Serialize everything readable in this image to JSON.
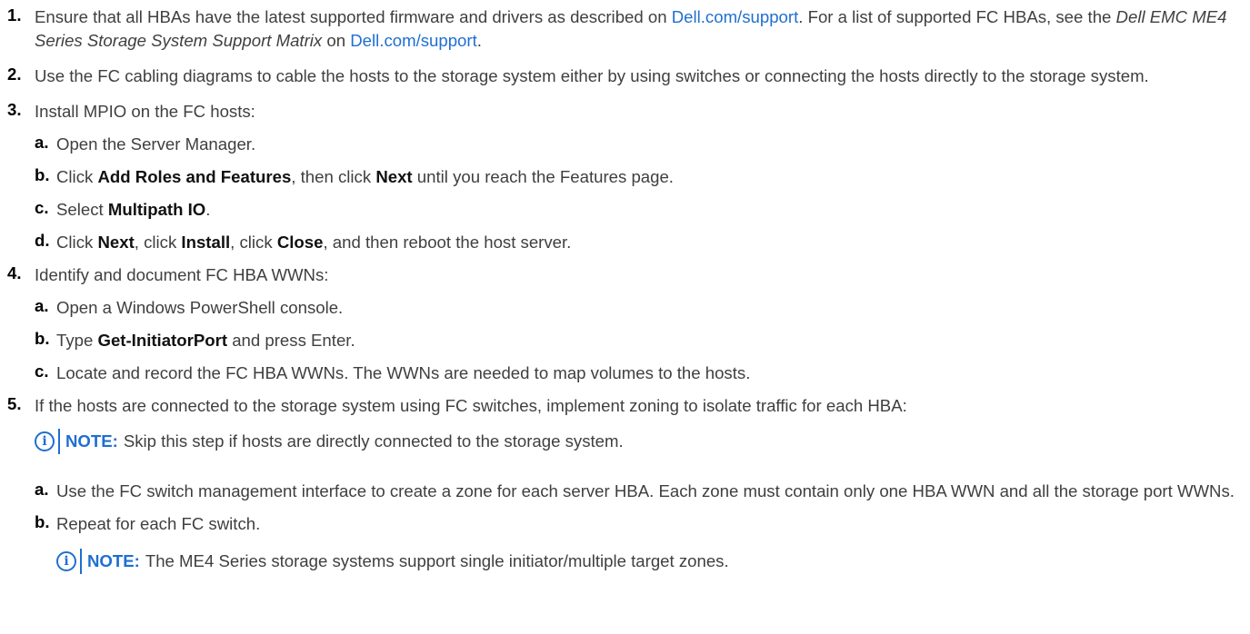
{
  "steps": [
    {
      "num": "1.",
      "p1": "Ensure that all HBAs have the latest supported firmware and drivers as described on ",
      "link1": "Dell.com/support",
      "p2": ". For a list of supported FC HBAs, see the ",
      "italic": "Dell EMC ME4 Series Storage System Support Matrix",
      "p3": " on ",
      "link2": "Dell.com/support",
      "p4": "."
    },
    {
      "num": "2.",
      "text": "Use the FC cabling diagrams to cable the hosts to the storage system either by using switches or connecting the hosts directly to the storage system."
    },
    {
      "num": "3.",
      "text": "Install MPIO on the FC hosts:",
      "sub": [
        {
          "num": "a.",
          "text": "Open the Server Manager."
        },
        {
          "num": "b.",
          "t1": "Click ",
          "b1": "Add Roles and Features",
          "t2": ", then click ",
          "b2": "Next",
          "t3": " until you reach the Features page."
        },
        {
          "num": "c.",
          "t1": "Select ",
          "b1": "Multipath IO",
          "t2": "."
        },
        {
          "num": "d.",
          "t1": "Click ",
          "b1": "Next",
          "t2": ", click ",
          "b2": "Install",
          "t3": ", click ",
          "b3": "Close",
          "t4": ", and then reboot the host server."
        }
      ]
    },
    {
      "num": "4.",
      "text": "Identify and document FC HBA WWNs:",
      "sub": [
        {
          "num": "a.",
          "text": "Open a Windows PowerShell console."
        },
        {
          "num": "b.",
          "t1": "Type ",
          "b1": "Get-InitiatorPort",
          "t2": " and press Enter."
        },
        {
          "num": "c.",
          "text": "Locate and record the FC HBA WWNs. The WWNs are needed to map volumes to the hosts."
        }
      ]
    },
    {
      "num": "5.",
      "text": "If the hosts are connected to the storage system using FC switches, implement zoning to isolate traffic for each HBA:",
      "note": {
        "label": "NOTE:",
        "text": "Skip this step if hosts are directly connected to the storage system."
      },
      "sub": [
        {
          "num": "a.",
          "text": "Use the FC switch management interface to create a zone for each server HBA. Each zone must contain only one HBA WWN and all the storage port WWNs."
        },
        {
          "num": "b.",
          "text": "Repeat for each FC switch."
        }
      ],
      "note2": {
        "label": "NOTE:",
        "text": "The ME4 Series storage systems support single initiator/multiple target zones."
      }
    }
  ],
  "icons": {
    "info": "info-icon"
  },
  "colors": {
    "link": "#1f6fd1",
    "note": "#1f6fd1"
  }
}
